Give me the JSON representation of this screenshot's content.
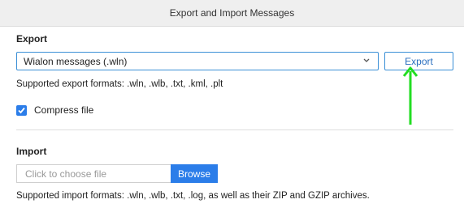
{
  "dialog": {
    "title": "Export and Import Messages"
  },
  "export": {
    "heading": "Export",
    "format_select": {
      "value": "Wialon messages (.wln)"
    },
    "export_button": "Export",
    "supported_formats": "Supported export formats: .wln, .wlb, .txt, .kml, .plt",
    "compress_checkbox": {
      "label": "Compress file",
      "checked": true
    }
  },
  "import": {
    "heading": "Import",
    "file_input": {
      "placeholder": "Click to choose file"
    },
    "browse_button": "Browse",
    "supported_formats": "Supported import formats: .wln, .wlb, .txt, .log, as well as their ZIP and GZIP archives."
  },
  "colors": {
    "accent": "#2b7de9",
    "annotation_arrow": "#22dd22"
  },
  "icons": {
    "select_chevron": "chevron-down-icon",
    "checkbox": "checkmark-icon",
    "annotation": "arrow-up-icon"
  }
}
